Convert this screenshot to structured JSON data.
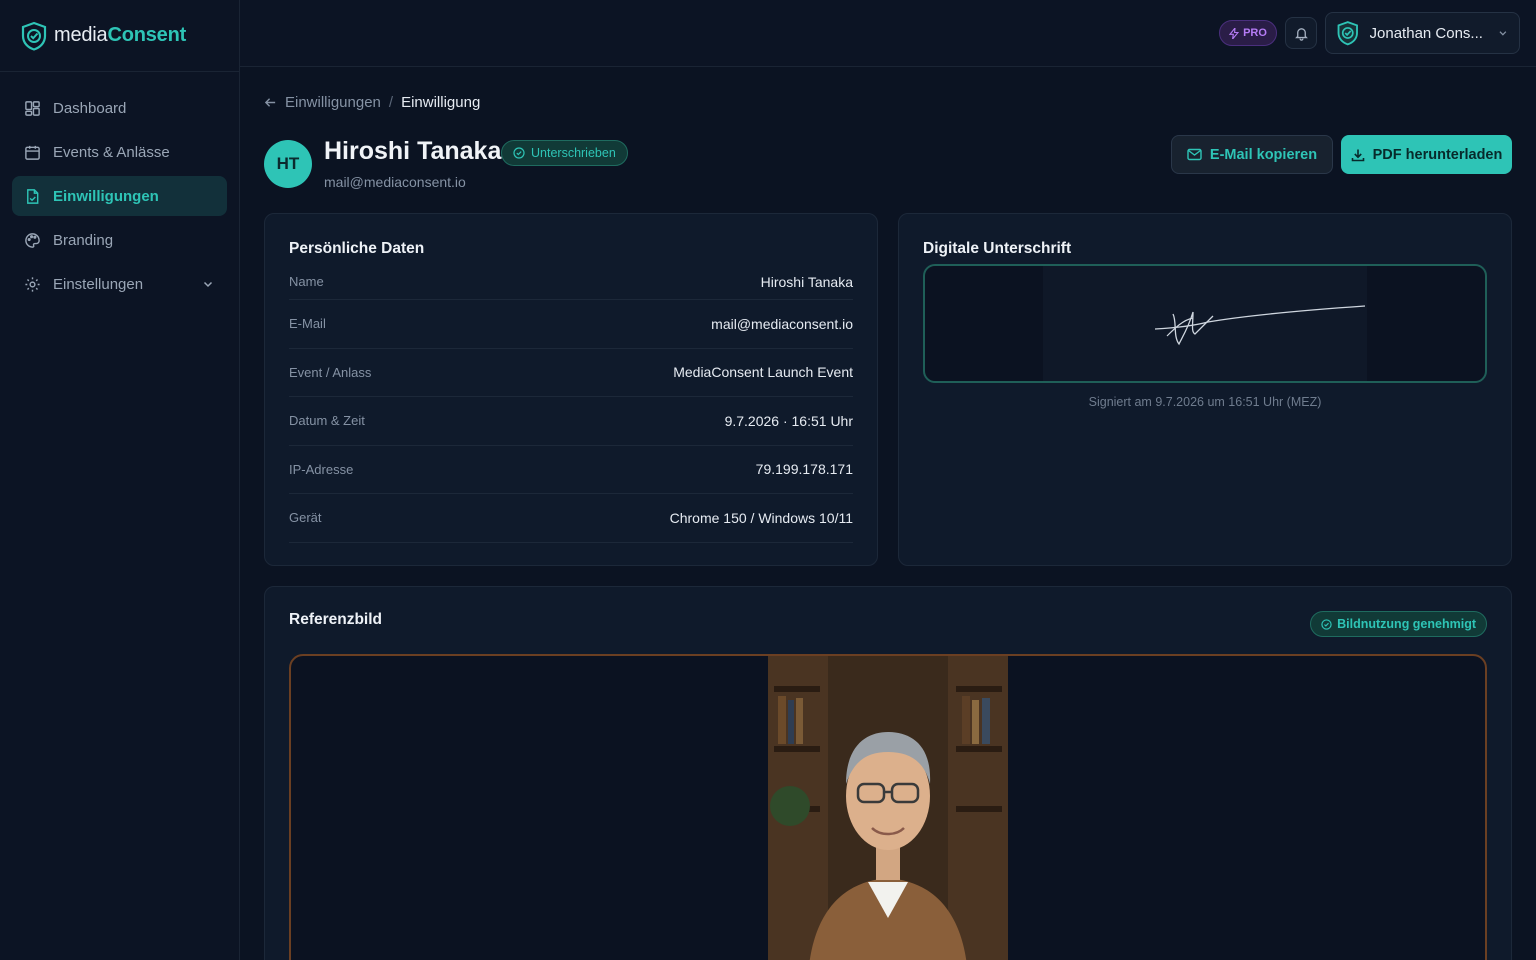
{
  "brand": {
    "name_part1": "media",
    "name_part2": "Consent"
  },
  "nav": {
    "items": [
      {
        "label": "Dashboard",
        "icon": "grid-icon"
      },
      {
        "label": "Events & Anlässe",
        "icon": "calendar-icon"
      },
      {
        "label": "Einwilligungen",
        "icon": "file-check-icon",
        "active": true
      },
      {
        "label": "Branding",
        "icon": "palette-icon"
      },
      {
        "label": "Einstellungen",
        "icon": "gear-icon"
      }
    ]
  },
  "topbar": {
    "pro_label": "PRO",
    "user_name": "Jonathan Cons..."
  },
  "breadcrumb": {
    "parent": "Einwilligungen",
    "current": "Einwilligung"
  },
  "person": {
    "initials": "HT",
    "name": "Hiroshi Tanaka",
    "email": "mail@mediaconsent.io",
    "status": "Unterschrieben"
  },
  "actions": {
    "copy_email": "E-Mail kopieren",
    "download_pdf": "PDF herunterladen"
  },
  "personal_data": {
    "title": "Persönliche Daten",
    "rows": [
      {
        "label": "Name",
        "value": "Hiroshi Tanaka"
      },
      {
        "label": "E-Mail",
        "value": "mail@mediaconsent.io"
      },
      {
        "label": "Event / Anlass",
        "value": "MediaConsent Launch Event"
      },
      {
        "label": "Datum & Zeit",
        "value": "9.7.2026 · 16:51 Uhr"
      },
      {
        "label": "IP-Adresse",
        "value": "79.199.178.171"
      },
      {
        "label": "Gerät",
        "value": "Chrome 150 / Windows 10/11"
      }
    ]
  },
  "signature": {
    "title": "Digitale Unterschrift",
    "caption": "Signiert am 9.7.2026 um 16:51 Uhr (MEZ)"
  },
  "reference": {
    "title": "Referenzbild",
    "badge": "Bildnutzung genehmigt"
  },
  "colors": {
    "accent": "#2ec4b6",
    "background": "#0b1322",
    "pro": "#b57cf5",
    "frame": "#6b3f22"
  }
}
